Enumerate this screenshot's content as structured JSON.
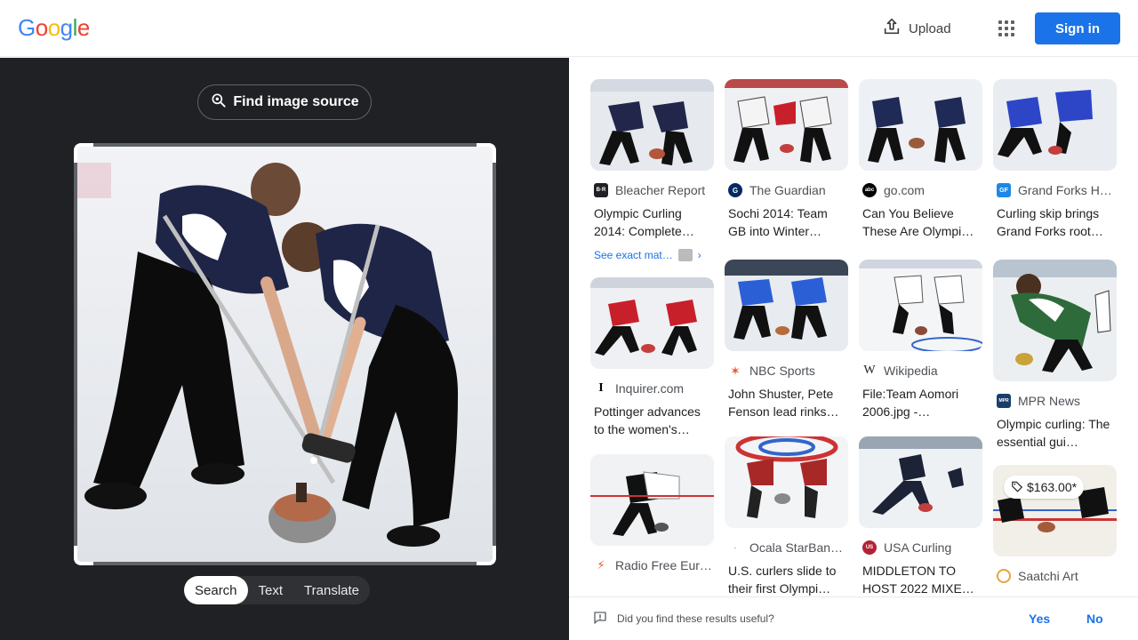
{
  "header": {
    "logo_letters": [
      "G",
      "o",
      "o",
      "g",
      "l",
      "e"
    ],
    "logo_colors": [
      "#4285f4",
      "#ea4335",
      "#fbbc05",
      "#4285f4",
      "#34a853",
      "#ea4335"
    ],
    "upload_label": "Upload",
    "signin_label": "Sign in"
  },
  "left": {
    "find_source_label": "Find image source",
    "tabs": [
      "Search",
      "Text",
      "Translate"
    ],
    "active_tab": "Search"
  },
  "results": [
    {
      "source": "Bleacher Report",
      "title": "Olympic Curling 2014: Complete…",
      "exact": "See exact mat…",
      "icon": "bleacher-report-icon",
      "fav_color": "#202124",
      "fav_text": "B·R"
    },
    {
      "source": "The Guardian",
      "title": "Sochi 2014: Team GB into Winter…",
      "icon": "guardian-icon",
      "fav_color": "#052962",
      "fav_text": "G"
    },
    {
      "source": "go.com",
      "title": "Can You Believe These Are Olympi…",
      "icon": "abc-icon",
      "fav_color": "#000000",
      "fav_text": "abc"
    },
    {
      "source": "Grand Forks H…",
      "title": "Curling skip brings Grand Forks root…",
      "icon": "grand-forks-icon",
      "fav_color": "#1e88e5",
      "fav_text": "GF"
    },
    {
      "source": "Inquirer.com",
      "title": "Pottinger advances to the women's…",
      "icon": "inquirer-icon",
      "fav_color": "#ffffff",
      "fav_text": "I"
    },
    {
      "source": "NBC Sports",
      "title": "John Shuster, Pete Fenson lead rinks…",
      "icon": "nbc-icon",
      "fav_color": "#ffffff",
      "fav_text": "✶"
    },
    {
      "source": "Wikipedia",
      "title": "File:Team Aomori 2006.jpg -…",
      "icon": "wikipedia-icon",
      "fav_color": "#ffffff",
      "fav_text": "W"
    },
    {
      "source": "MPR News",
      "title": "Olympic curling: The essential gui…",
      "icon": "mpr-icon",
      "fav_color": "#1a3e6b",
      "fav_text": "MPR"
    },
    {
      "source": "Radio Free Eur…",
      "title": "",
      "icon": "rfe-icon",
      "fav_color": "#ffffff",
      "fav_text": "⚡"
    },
    {
      "source": "Ocala StarBan…",
      "title": "U.S. curlers slide to their first Olympi…",
      "icon": "ocala-icon",
      "fav_color": "#ffffff",
      "fav_text": "·"
    },
    {
      "source": "USA Curling",
      "title": "MIDDLETON TO HOST 2022 MIXE…",
      "icon": "usa-curling-icon",
      "fav_color": "#b22234",
      "fav_text": "US"
    },
    {
      "source": "Saatchi Art",
      "title": "",
      "price": "$163.00*",
      "icon": "saatchi-icon",
      "fav_color": "#ffffff",
      "fav_text": "◌"
    }
  ],
  "feedback": {
    "question": "Did you find these results useful?",
    "yes": "Yes",
    "no": "No"
  }
}
